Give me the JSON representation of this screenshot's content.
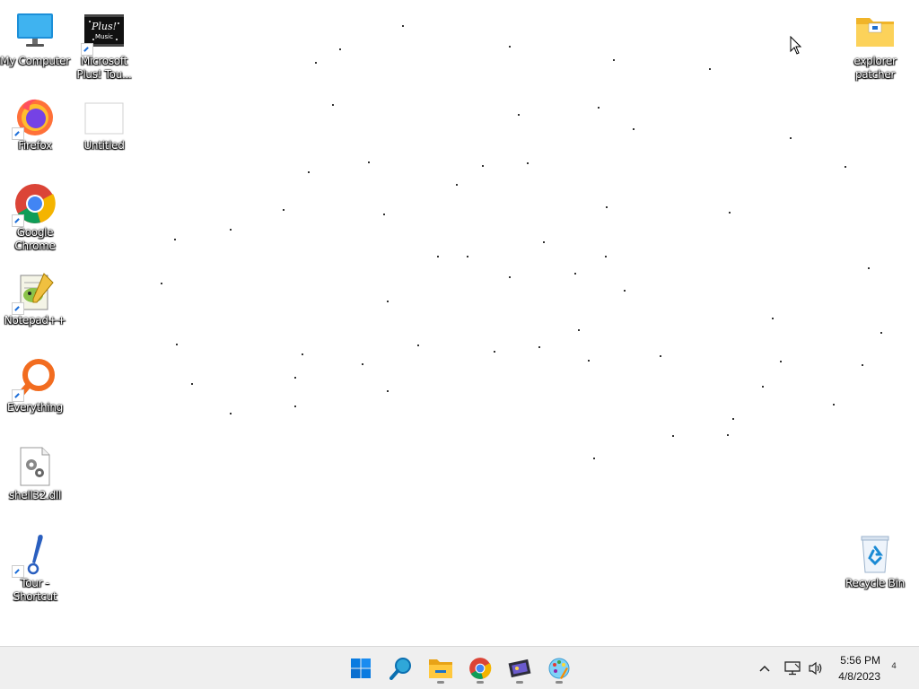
{
  "desktop": {
    "icons": [
      {
        "label": "My Computer",
        "icon": "monitor-icon"
      },
      {
        "label": "Microsoft Plus! Tou...",
        "icon": "plus-music-icon"
      },
      {
        "label": "Firefox",
        "icon": "firefox-icon"
      },
      {
        "label": "Untitled",
        "icon": "blank-file-icon"
      },
      {
        "label": "Google Chrome",
        "icon": "chrome-icon"
      },
      {
        "label": "Notepad++",
        "icon": "notepadpp-icon"
      },
      {
        "label": "Everything",
        "icon": "everything-search-icon"
      },
      {
        "label": "shell32.dll",
        "icon": "dll-file-icon"
      },
      {
        "label": "Tour - Shortcut",
        "icon": "tour-icon"
      },
      {
        "label": "explorer patcher",
        "icon": "folder-icon"
      },
      {
        "label": "Recycle Bin",
        "icon": "recycle-bin-icon"
      }
    ],
    "plus_icon_text": "Plus! Music"
  },
  "taskbar": {
    "apps": [
      {
        "name": "Start",
        "icon": "windows-start-icon"
      },
      {
        "name": "Search",
        "icon": "search-magnifier-icon"
      },
      {
        "name": "File Explorer",
        "icon": "file-explorer-icon"
      },
      {
        "name": "Google Chrome",
        "icon": "chrome-icon"
      },
      {
        "name": "Media Player",
        "icon": "film-icon"
      },
      {
        "name": "Paint",
        "icon": "paint-palette-icon"
      }
    ],
    "tray": {
      "chevron": "^",
      "time": "5:56 PM",
      "date": "4/8/2023",
      "notification_count": "4"
    }
  },
  "colors": {
    "taskbar_bg": "#efefef",
    "accent_blue": "#0067c0",
    "desktop_bg": "#ffffff"
  }
}
